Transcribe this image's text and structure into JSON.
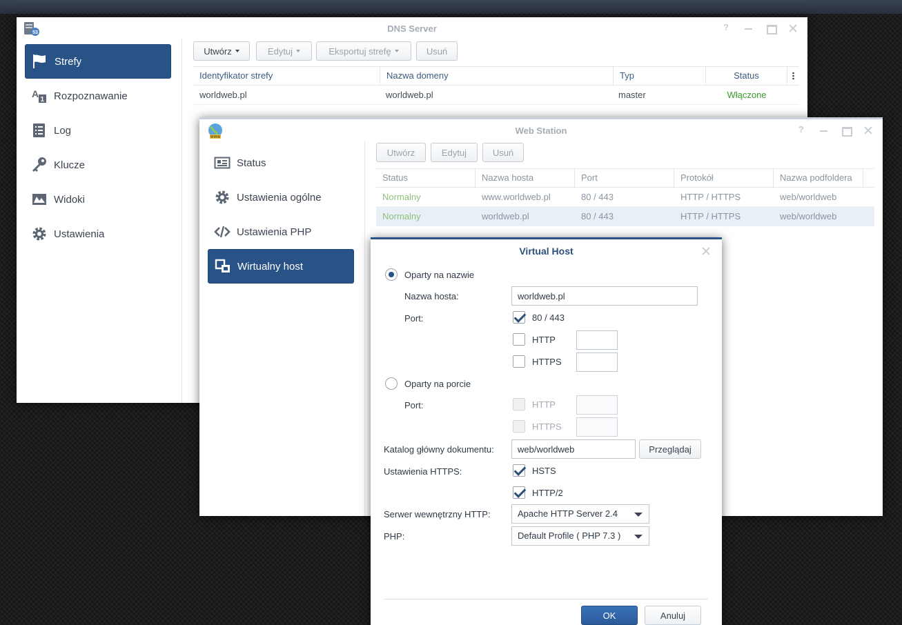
{
  "dns": {
    "title": "DNS Server",
    "sidebar": [
      {
        "label": "Strefy",
        "icon": "flag-icon",
        "active": true
      },
      {
        "label": "Rozpoznawanie",
        "icon": "resolve-icon"
      },
      {
        "label": "Log",
        "icon": "list-icon"
      },
      {
        "label": "Klucze",
        "icon": "key-icon"
      },
      {
        "label": "Widoki",
        "icon": "map-icon"
      },
      {
        "label": "Ustawienia",
        "icon": "gear-icon"
      }
    ],
    "toolbar": {
      "create": "Utwórz",
      "edit": "Edytuj",
      "export": "Eksportuj strefę",
      "delete": "Usuń"
    },
    "columns": [
      "Identyfikator strefy",
      "Nazwa domeny",
      "Typ",
      "Status"
    ],
    "rows": [
      {
        "id": "worldweb.pl",
        "domain": "worldweb.pl",
        "type": "master",
        "status": "Włączone"
      }
    ]
  },
  "webstation": {
    "title": "Web Station",
    "sidebar": [
      {
        "label": "Status",
        "icon": "status-card-icon"
      },
      {
        "label": "Ustawienia ogólne",
        "icon": "gear-icon"
      },
      {
        "label": "Ustawienia PHP",
        "icon": "code-icon"
      },
      {
        "label": "Wirtualny host",
        "icon": "virtual-host-icon",
        "active": true
      }
    ],
    "toolbar": {
      "create": "Utwórz",
      "edit": "Edytuj",
      "delete": "Usuń"
    },
    "columns": [
      "Status",
      "Nazwa hosta",
      "Port",
      "Protokół",
      "Nazwa podfoldera"
    ],
    "rows": [
      {
        "status": "Normalny",
        "host": "www.worldweb.pl",
        "port": "80 / 443",
        "protocol": "HTTP / HTTPS",
        "folder": "web/worldweb"
      },
      {
        "status": "Normalny",
        "host": "worldweb.pl",
        "port": "80 / 443",
        "protocol": "HTTP / HTTPS",
        "folder": "web/worldweb"
      }
    ]
  },
  "dialog": {
    "title": "Virtual Host",
    "name_based": "Oparty na nazwie",
    "hostname_label": "Nazwa hosta:",
    "hostname_value": "worldweb.pl",
    "port_label": "Port:",
    "port_default": "80 / 443",
    "http": "HTTP",
    "https": "HTTPS",
    "port_based": "Oparty na porcie",
    "port_label2": "Port:",
    "http2": "HTTP",
    "https2": "HTTPS",
    "docroot_label": "Katalog główny dokumentu:",
    "docroot_value": "web/worldweb",
    "browse": "Przeglądaj",
    "https_settings_label": "Ustawienia HTTPS:",
    "hsts": "HSTS",
    "http2_opt": "HTTP/2",
    "backend_label": "Serwer wewnętrzny HTTP:",
    "backend_value": "Apache HTTP Server 2.4",
    "php_label": "PHP:",
    "php_value": "Default Profile ( PHP 7.3 )",
    "ok": "OK",
    "cancel": "Anuluj"
  },
  "colors": {
    "accent": "#295286",
    "status_ok": "#3a9a2b",
    "status_normal": "#7bb35a"
  }
}
